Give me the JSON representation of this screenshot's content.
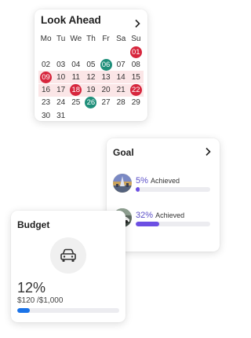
{
  "calendar": {
    "title": "Look Ahead",
    "weekdays": [
      "Mo",
      "Tu",
      "We",
      "Th",
      "Fr",
      "Sa",
      "Su"
    ],
    "weeks": [
      [
        {
          "d": ""
        },
        {
          "d": ""
        },
        {
          "d": ""
        },
        {
          "d": ""
        },
        {
          "d": ""
        },
        {
          "d": ""
        },
        {
          "d": "01",
          "mark": "red"
        }
      ],
      [
        {
          "d": "02"
        },
        {
          "d": "03"
        },
        {
          "d": "04"
        },
        {
          "d": "05"
        },
        {
          "d": "06",
          "mark": "teal"
        },
        {
          "d": "07"
        },
        {
          "d": "08"
        }
      ],
      [
        {
          "d": "09",
          "mark": "red"
        },
        {
          "d": "10"
        },
        {
          "d": "11"
        },
        {
          "d": "12"
        },
        {
          "d": "13"
        },
        {
          "d": "14"
        },
        {
          "d": "15"
        }
      ],
      [
        {
          "d": "16"
        },
        {
          "d": "17"
        },
        {
          "d": "18",
          "mark": "red"
        },
        {
          "d": "19"
        },
        {
          "d": "20"
        },
        {
          "d": "21"
        },
        {
          "d": "22",
          "mark": "red"
        }
      ],
      [
        {
          "d": "23"
        },
        {
          "d": "24"
        },
        {
          "d": "25"
        },
        {
          "d": "26",
          "mark": "teal"
        },
        {
          "d": "27"
        },
        {
          "d": "28"
        },
        {
          "d": "29"
        }
      ],
      [
        {
          "d": "30"
        },
        {
          "d": "31"
        },
        {
          "d": ""
        },
        {
          "d": ""
        },
        {
          "d": ""
        },
        {
          "d": ""
        },
        {
          "d": ""
        }
      ]
    ],
    "highlighted_weeks": [
      2,
      3
    ],
    "colors": {
      "red": "#d7263d",
      "teal": "#1f8f7a",
      "highlight": "#fbe6e7"
    }
  },
  "goal": {
    "title": "Goal",
    "items": [
      {
        "percent": "5%",
        "label": "Achieved",
        "progress": 0.05,
        "image": "city-landmark-photo"
      },
      {
        "percent": "32%",
        "label": "Achieved",
        "progress": 0.32,
        "image": "car-photo"
      }
    ],
    "accent": "#6c4fe3"
  },
  "budget": {
    "title": "Budget",
    "icon": "car-icon",
    "percent": "12%",
    "amount": "$120 /$1,000",
    "progress": 0.12,
    "accent": "#1a73e8"
  }
}
